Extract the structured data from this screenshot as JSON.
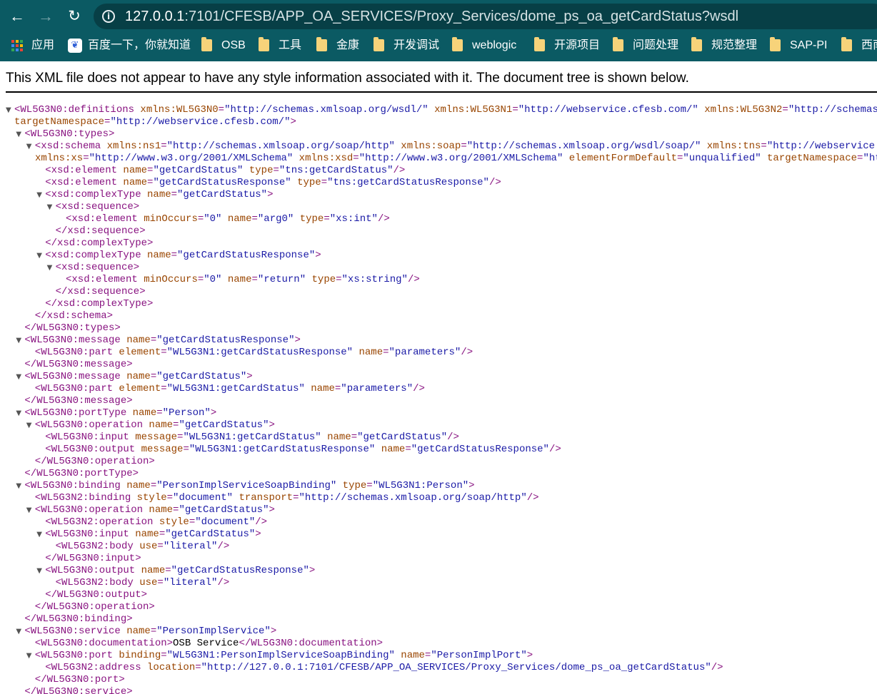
{
  "browser": {
    "url_host": "127.0.0.1",
    "url_rest": ":7101/CFESB/APP_OA_SERVICES/Proxy_Services/dome_ps_oa_getCardStatus?wsdl",
    "bookmarks": [
      {
        "label": "应用",
        "icon": "apps-grid-icon"
      },
      {
        "label": "百度一下，你就知道",
        "icon": "baidu-paw-icon"
      },
      {
        "label": "OSB",
        "icon": "folder-icon"
      },
      {
        "label": "工具",
        "icon": "folder-icon"
      },
      {
        "label": "金康",
        "icon": "folder-icon"
      },
      {
        "label": "开发调试",
        "icon": "folder-icon"
      },
      {
        "label": "weblogic",
        "icon": "folder-icon"
      },
      {
        "label": "开源项目",
        "icon": "folder-icon"
      },
      {
        "label": "问题处理",
        "icon": "folder-icon"
      },
      {
        "label": "规范整理",
        "icon": "folder-icon"
      },
      {
        "label": "SAP-PI",
        "icon": "folder-icon"
      },
      {
        "label": "西南",
        "icon": "folder-icon"
      }
    ]
  },
  "notice": "This XML file does not appear to have any style information associated with it. The document tree is shown below.",
  "colors": {
    "toolbar": "#0b5a63",
    "tag": "#881280",
    "attr_name": "#994500",
    "attr_value": "#1a1aa6"
  },
  "xml_lines": [
    {
      "toggle": true,
      "parts": [
        [
          "t",
          "<WL5G3N0:definitions"
        ],
        [
          "n",
          " xmlns:WL5G3N0"
        ],
        [
          "t",
          "="
        ],
        [
          "v",
          "\"http://schemas.xmlsoap.org/wsdl/\""
        ],
        [
          "n",
          " xmlns:WL5G3N1"
        ],
        [
          "t",
          "="
        ],
        [
          "v",
          "\"http://webservice.cfesb.com/\""
        ],
        [
          "n",
          " xmlns:WL5G3N2"
        ],
        [
          "t",
          "="
        ],
        [
          "v",
          "\"http://schemas.xmlsoap.org/wsdl/soap/\""
        ]
      ]
    },
    {
      "toggle": false,
      "cont": 20,
      "parts": [
        [
          "n",
          "targetNamespace"
        ],
        [
          "t",
          "="
        ],
        [
          "v",
          "\"http://webservice.cfesb.com/\""
        ],
        [
          "t",
          ">"
        ]
      ]
    },
    {
      "toggle": true,
      "indent": 1,
      "parts": [
        [
          "t",
          "<WL5G3N0:types>"
        ]
      ]
    },
    {
      "toggle": true,
      "indent": 2,
      "parts": [
        [
          "t",
          "<xsd:schema"
        ],
        [
          "n",
          " xmlns:ns1"
        ],
        [
          "t",
          "="
        ],
        [
          "v",
          "\"http://schemas.xmlsoap.org/soap/http\""
        ],
        [
          "n",
          " xmlns:soap"
        ],
        [
          "t",
          "="
        ],
        [
          "v",
          "\"http://schemas.xmlsoap.org/wsdl/soap/\""
        ],
        [
          "n",
          " xmlns:tns"
        ],
        [
          "t",
          "="
        ],
        [
          "v",
          "\"http://webservice.cfesb.com/\""
        ]
      ]
    },
    {
      "toggle": false,
      "cont": 49,
      "parts": [
        [
          "n",
          "xmlns:xs"
        ],
        [
          "t",
          "="
        ],
        [
          "v",
          "\"http://www.w3.org/2001/XMLSchema\""
        ],
        [
          "n",
          " xmlns:xsd"
        ],
        [
          "t",
          "="
        ],
        [
          "v",
          "\"http://www.w3.org/2001/XMLSchema\""
        ],
        [
          "n",
          " elementFormDefault"
        ],
        [
          "t",
          "="
        ],
        [
          "v",
          "\"unqualified\""
        ],
        [
          "n",
          " targetNamespace"
        ],
        [
          "t",
          "="
        ],
        [
          "v",
          "\"http://webservice.cfesb.com/\""
        ],
        [
          "t",
          ">"
        ]
      ]
    },
    {
      "toggle": false,
      "indent": 3,
      "parts": [
        [
          "t",
          "<xsd:element"
        ],
        [
          "n",
          " name"
        ],
        [
          "t",
          "="
        ],
        [
          "v",
          "\"getCardStatus\""
        ],
        [
          "n",
          " type"
        ],
        [
          "t",
          "="
        ],
        [
          "v",
          "\"tns:getCardStatus\""
        ],
        [
          "t",
          "/>"
        ]
      ]
    },
    {
      "toggle": false,
      "indent": 3,
      "parts": [
        [
          "t",
          "<xsd:element"
        ],
        [
          "n",
          " name"
        ],
        [
          "t",
          "="
        ],
        [
          "v",
          "\"getCardStatusResponse\""
        ],
        [
          "n",
          " type"
        ],
        [
          "t",
          "="
        ],
        [
          "v",
          "\"tns:getCardStatusResponse\""
        ],
        [
          "t",
          "/>"
        ]
      ]
    },
    {
      "toggle": true,
      "indent": 3,
      "parts": [
        [
          "t",
          "<xsd:complexType"
        ],
        [
          "n",
          " name"
        ],
        [
          "t",
          "="
        ],
        [
          "v",
          "\"getCardStatus\""
        ],
        [
          "t",
          ">"
        ]
      ]
    },
    {
      "toggle": true,
      "indent": 4,
      "parts": [
        [
          "t",
          "<xsd:sequence>"
        ]
      ]
    },
    {
      "toggle": false,
      "indent": 5,
      "parts": [
        [
          "t",
          "<xsd:element"
        ],
        [
          "n",
          " minOccurs"
        ],
        [
          "t",
          "="
        ],
        [
          "v",
          "\"0\""
        ],
        [
          "n",
          " name"
        ],
        [
          "t",
          "="
        ],
        [
          "v",
          "\"arg0\""
        ],
        [
          "n",
          " type"
        ],
        [
          "t",
          "="
        ],
        [
          "v",
          "\"xs:int\""
        ],
        [
          "t",
          "/>"
        ]
      ]
    },
    {
      "toggle": false,
      "indent": 4,
      "parts": [
        [
          "t",
          "</xsd:sequence>"
        ]
      ]
    },
    {
      "toggle": false,
      "indent": 3,
      "parts": [
        [
          "t",
          "</xsd:complexType>"
        ]
      ]
    },
    {
      "toggle": true,
      "indent": 3,
      "parts": [
        [
          "t",
          "<xsd:complexType"
        ],
        [
          "n",
          " name"
        ],
        [
          "t",
          "="
        ],
        [
          "v",
          "\"getCardStatusResponse\""
        ],
        [
          "t",
          ">"
        ]
      ]
    },
    {
      "toggle": true,
      "indent": 4,
      "parts": [
        [
          "t",
          "<xsd:sequence>"
        ]
      ]
    },
    {
      "toggle": false,
      "indent": 5,
      "parts": [
        [
          "t",
          "<xsd:element"
        ],
        [
          "n",
          " minOccurs"
        ],
        [
          "t",
          "="
        ],
        [
          "v",
          "\"0\""
        ],
        [
          "n",
          " name"
        ],
        [
          "t",
          "="
        ],
        [
          "v",
          "\"return\""
        ],
        [
          "n",
          " type"
        ],
        [
          "t",
          "="
        ],
        [
          "v",
          "\"xs:string\""
        ],
        [
          "t",
          "/>"
        ]
      ]
    },
    {
      "toggle": false,
      "indent": 4,
      "parts": [
        [
          "t",
          "</xsd:sequence>"
        ]
      ]
    },
    {
      "toggle": false,
      "indent": 3,
      "parts": [
        [
          "t",
          "</xsd:complexType>"
        ]
      ]
    },
    {
      "toggle": false,
      "indent": 2,
      "parts": [
        [
          "t",
          "</xsd:schema>"
        ]
      ]
    },
    {
      "toggle": false,
      "indent": 1,
      "parts": [
        [
          "t",
          "</WL5G3N0:types>"
        ]
      ]
    },
    {
      "toggle": true,
      "indent": 1,
      "parts": [
        [
          "t",
          "<WL5G3N0:message"
        ],
        [
          "n",
          " name"
        ],
        [
          "t",
          "="
        ],
        [
          "v",
          "\"getCardStatusResponse\""
        ],
        [
          "t",
          ">"
        ]
      ]
    },
    {
      "toggle": false,
      "indent": 2,
      "parts": [
        [
          "t",
          "<WL5G3N0:part"
        ],
        [
          "n",
          " element"
        ],
        [
          "t",
          "="
        ],
        [
          "v",
          "\"WL5G3N1:getCardStatusResponse\""
        ],
        [
          "n",
          " name"
        ],
        [
          "t",
          "="
        ],
        [
          "v",
          "\"parameters\""
        ],
        [
          "t",
          "/>"
        ]
      ]
    },
    {
      "toggle": false,
      "indent": 1,
      "parts": [
        [
          "t",
          "</WL5G3N0:message>"
        ]
      ]
    },
    {
      "toggle": true,
      "indent": 1,
      "parts": [
        [
          "t",
          "<WL5G3N0:message"
        ],
        [
          "n",
          " name"
        ],
        [
          "t",
          "="
        ],
        [
          "v",
          "\"getCardStatus\""
        ],
        [
          "t",
          ">"
        ]
      ]
    },
    {
      "toggle": false,
      "indent": 2,
      "parts": [
        [
          "t",
          "<WL5G3N0:part"
        ],
        [
          "n",
          " element"
        ],
        [
          "t",
          "="
        ],
        [
          "v",
          "\"WL5G3N1:getCardStatus\""
        ],
        [
          "n",
          " name"
        ],
        [
          "t",
          "="
        ],
        [
          "v",
          "\"parameters\""
        ],
        [
          "t",
          "/>"
        ]
      ]
    },
    {
      "toggle": false,
      "indent": 1,
      "parts": [
        [
          "t",
          "</WL5G3N0:message>"
        ]
      ]
    },
    {
      "toggle": true,
      "indent": 1,
      "parts": [
        [
          "t",
          "<WL5G3N0:portType"
        ],
        [
          "n",
          " name"
        ],
        [
          "t",
          "="
        ],
        [
          "v",
          "\"Person\""
        ],
        [
          "t",
          ">"
        ]
      ]
    },
    {
      "toggle": true,
      "indent": 2,
      "parts": [
        [
          "t",
          "<WL5G3N0:operation"
        ],
        [
          "n",
          " name"
        ],
        [
          "t",
          "="
        ],
        [
          "v",
          "\"getCardStatus\""
        ],
        [
          "t",
          ">"
        ]
      ]
    },
    {
      "toggle": false,
      "indent": 3,
      "parts": [
        [
          "t",
          "<WL5G3N0:input"
        ],
        [
          "n",
          " message"
        ],
        [
          "t",
          "="
        ],
        [
          "v",
          "\"WL5G3N1:getCardStatus\""
        ],
        [
          "n",
          " name"
        ],
        [
          "t",
          "="
        ],
        [
          "v",
          "\"getCardStatus\""
        ],
        [
          "t",
          "/>"
        ]
      ]
    },
    {
      "toggle": false,
      "indent": 3,
      "parts": [
        [
          "t",
          "<WL5G3N0:output"
        ],
        [
          "n",
          " message"
        ],
        [
          "t",
          "="
        ],
        [
          "v",
          "\"WL5G3N1:getCardStatusResponse\""
        ],
        [
          "n",
          " name"
        ],
        [
          "t",
          "="
        ],
        [
          "v",
          "\"getCardStatusResponse\""
        ],
        [
          "t",
          "/>"
        ]
      ]
    },
    {
      "toggle": false,
      "indent": 2,
      "parts": [
        [
          "t",
          "</WL5G3N0:operation>"
        ]
      ]
    },
    {
      "toggle": false,
      "indent": 1,
      "parts": [
        [
          "t",
          "</WL5G3N0:portType>"
        ]
      ]
    },
    {
      "toggle": true,
      "indent": 1,
      "parts": [
        [
          "t",
          "<WL5G3N0:binding"
        ],
        [
          "n",
          " name"
        ],
        [
          "t",
          "="
        ],
        [
          "v",
          "\"PersonImplServiceSoapBinding\""
        ],
        [
          "n",
          " type"
        ],
        [
          "t",
          "="
        ],
        [
          "v",
          "\"WL5G3N1:Person\""
        ],
        [
          "t",
          ">"
        ]
      ]
    },
    {
      "toggle": false,
      "indent": 2,
      "parts": [
        [
          "t",
          "<WL5G3N2:binding"
        ],
        [
          "n",
          " style"
        ],
        [
          "t",
          "="
        ],
        [
          "v",
          "\"document\""
        ],
        [
          "n",
          " transport"
        ],
        [
          "t",
          "="
        ],
        [
          "v",
          "\"http://schemas.xmlsoap.org/soap/http\""
        ],
        [
          "t",
          "/>"
        ]
      ]
    },
    {
      "toggle": true,
      "indent": 2,
      "parts": [
        [
          "t",
          "<WL5G3N0:operation"
        ],
        [
          "n",
          " name"
        ],
        [
          "t",
          "="
        ],
        [
          "v",
          "\"getCardStatus\""
        ],
        [
          "t",
          ">"
        ]
      ]
    },
    {
      "toggle": false,
      "indent": 3,
      "parts": [
        [
          "t",
          "<WL5G3N2:operation"
        ],
        [
          "n",
          " style"
        ],
        [
          "t",
          "="
        ],
        [
          "v",
          "\"document\""
        ],
        [
          "t",
          "/>"
        ]
      ]
    },
    {
      "toggle": true,
      "indent": 3,
      "parts": [
        [
          "t",
          "<WL5G3N0:input"
        ],
        [
          "n",
          " name"
        ],
        [
          "t",
          "="
        ],
        [
          "v",
          "\"getCardStatus\""
        ],
        [
          "t",
          ">"
        ]
      ]
    },
    {
      "toggle": false,
      "indent": 4,
      "parts": [
        [
          "t",
          "<WL5G3N2:body"
        ],
        [
          "n",
          " use"
        ],
        [
          "t",
          "="
        ],
        [
          "v",
          "\"literal\""
        ],
        [
          "t",
          "/>"
        ]
      ]
    },
    {
      "toggle": false,
      "indent": 3,
      "parts": [
        [
          "t",
          "</WL5G3N0:input>"
        ]
      ]
    },
    {
      "toggle": true,
      "indent": 3,
      "parts": [
        [
          "t",
          "<WL5G3N0:output"
        ],
        [
          "n",
          " name"
        ],
        [
          "t",
          "="
        ],
        [
          "v",
          "\"getCardStatusResponse\""
        ],
        [
          "t",
          ">"
        ]
      ]
    },
    {
      "toggle": false,
      "indent": 4,
      "parts": [
        [
          "t",
          "<WL5G3N2:body"
        ],
        [
          "n",
          " use"
        ],
        [
          "t",
          "="
        ],
        [
          "v",
          "\"literal\""
        ],
        [
          "t",
          "/>"
        ]
      ]
    },
    {
      "toggle": false,
      "indent": 3,
      "parts": [
        [
          "t",
          "</WL5G3N0:output>"
        ]
      ]
    },
    {
      "toggle": false,
      "indent": 2,
      "parts": [
        [
          "t",
          "</WL5G3N0:operation>"
        ]
      ]
    },
    {
      "toggle": false,
      "indent": 1,
      "parts": [
        [
          "t",
          "</WL5G3N0:binding>"
        ]
      ]
    },
    {
      "toggle": true,
      "indent": 1,
      "parts": [
        [
          "t",
          "<WL5G3N0:service"
        ],
        [
          "n",
          " name"
        ],
        [
          "t",
          "="
        ],
        [
          "v",
          "\"PersonImplService\""
        ],
        [
          "t",
          ">"
        ]
      ]
    },
    {
      "toggle": false,
      "indent": 2,
      "parts": [
        [
          "t",
          "<WL5G3N0:documentation>"
        ],
        [
          "x",
          "OSB Service"
        ],
        [
          "t",
          "</WL5G3N0:documentation>"
        ]
      ]
    },
    {
      "toggle": true,
      "indent": 2,
      "parts": [
        [
          "t",
          "<WL5G3N0:port"
        ],
        [
          "n",
          " binding"
        ],
        [
          "t",
          "="
        ],
        [
          "v",
          "\"WL5G3N1:PersonImplServiceSoapBinding\""
        ],
        [
          "n",
          " name"
        ],
        [
          "t",
          "="
        ],
        [
          "v",
          "\"PersonImplPort\""
        ],
        [
          "t",
          ">"
        ]
      ]
    },
    {
      "toggle": false,
      "indent": 3,
      "parts": [
        [
          "t",
          "<WL5G3N2:address"
        ],
        [
          "n",
          " location"
        ],
        [
          "t",
          "="
        ],
        [
          "v",
          "\"http://127.0.0.1:7101/CFESB/APP_OA_SERVICES/Proxy_Services/dome_ps_oa_getCardStatus\""
        ],
        [
          "t",
          "/>"
        ]
      ]
    },
    {
      "toggle": false,
      "indent": 2,
      "parts": [
        [
          "t",
          "</WL5G3N0:port>"
        ]
      ]
    },
    {
      "toggle": false,
      "indent": 1,
      "parts": [
        [
          "t",
          "</WL5G3N0:service>"
        ]
      ]
    }
  ]
}
